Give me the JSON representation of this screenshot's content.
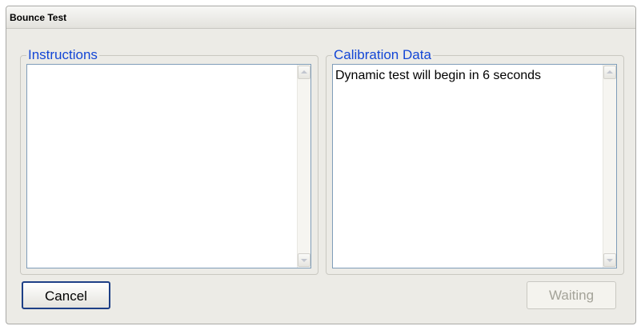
{
  "window": {
    "title": "Bounce Test"
  },
  "instructions": {
    "legend": "Instructions",
    "text": ""
  },
  "calibration": {
    "legend": "Calibration Data",
    "text": "Dynamic test will begin in 6 seconds"
  },
  "buttons": {
    "cancel_label": "Cancel",
    "waiting_label": "Waiting"
  },
  "icons": {
    "scroll_up": "chevron-up-icon",
    "scroll_down": "chevron-down-icon"
  }
}
